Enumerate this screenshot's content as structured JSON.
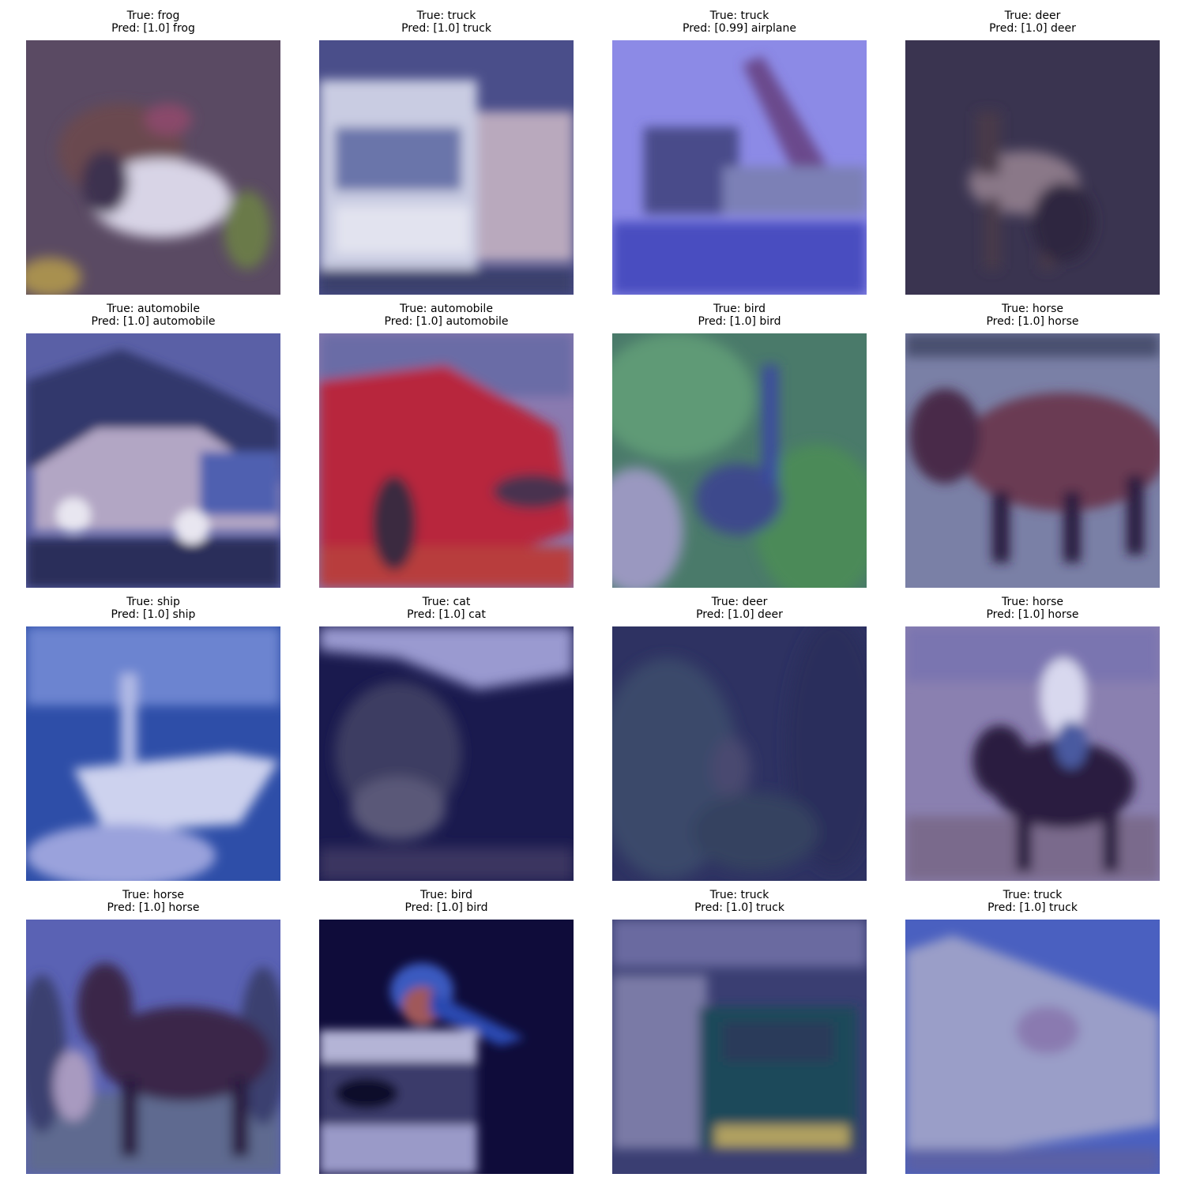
{
  "panels": [
    {
      "true_label": "True: frog",
      "pred_label": "Pred: [1.0] frog"
    },
    {
      "true_label": "True: truck",
      "pred_label": "Pred: [1.0] truck"
    },
    {
      "true_label": "True: truck",
      "pred_label": "Pred: [0.99] airplane"
    },
    {
      "true_label": "True: deer",
      "pred_label": "Pred: [1.0] deer"
    },
    {
      "true_label": "True: automobile",
      "pred_label": "Pred: [1.0] automobile"
    },
    {
      "true_label": "True: automobile",
      "pred_label": "Pred: [1.0] automobile"
    },
    {
      "true_label": "True: bird",
      "pred_label": "Pred: [1.0] bird"
    },
    {
      "true_label": "True: horse",
      "pred_label": "Pred: [1.0] horse"
    },
    {
      "true_label": "True: ship",
      "pred_label": "Pred: [1.0] ship"
    },
    {
      "true_label": "True: cat",
      "pred_label": "Pred: [1.0] cat"
    },
    {
      "true_label": "True: deer",
      "pred_label": "Pred: [1.0] deer"
    },
    {
      "true_label": "True: horse",
      "pred_label": "Pred: [1.0] horse"
    },
    {
      "true_label": "True: horse",
      "pred_label": "Pred: [1.0] horse"
    },
    {
      "true_label": "True: bird",
      "pred_label": "Pred: [1.0] bird"
    },
    {
      "true_label": "True: truck",
      "pred_label": "Pred: [1.0] truck"
    },
    {
      "true_label": "True: truck",
      "pred_label": "Pred: [1.0] truck"
    }
  ]
}
